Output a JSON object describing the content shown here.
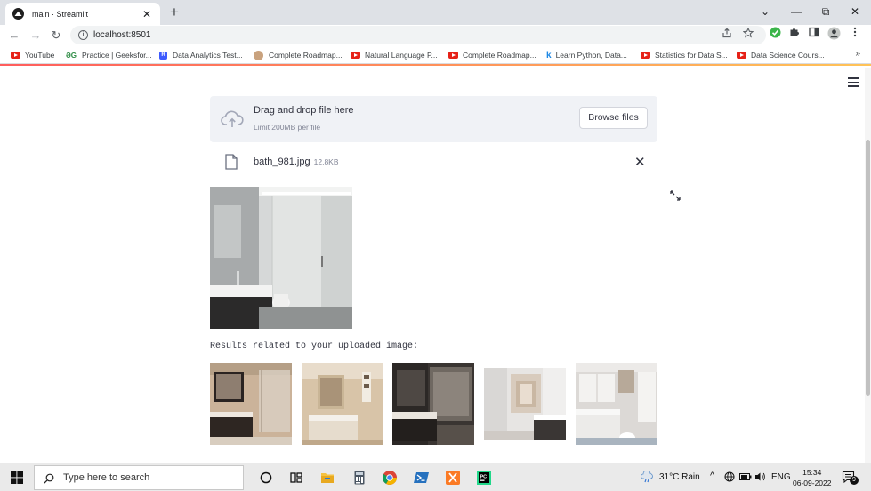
{
  "browser": {
    "tab_title": "main · Streamlit",
    "tab_close": "✕",
    "new_tab": "+",
    "window_controls": {
      "minimize": "—",
      "maximize": "⧉",
      "close": "✕",
      "tab_list": "⌄"
    },
    "url": "localhost:8501",
    "nav": {
      "back": "←",
      "forward": "→",
      "reload": "↻"
    }
  },
  "bookmarks": [
    {
      "icon": "youtube",
      "label": "YouTube"
    },
    {
      "icon": "gfg",
      "label": "Practice | Geeksfor..."
    },
    {
      "icon": "r",
      "label": "Data Analytics Test..."
    },
    {
      "icon": "avatar",
      "label": "Complete Roadmap..."
    },
    {
      "icon": "youtube",
      "label": "Natural Language P..."
    },
    {
      "icon": "youtube",
      "label": "Complete Roadmap..."
    },
    {
      "icon": "k",
      "label": "Learn Python, Data..."
    },
    {
      "icon": "youtube",
      "label": "Statistics for Data S..."
    },
    {
      "icon": "youtube",
      "label": "Data Science Cours..."
    }
  ],
  "bookmarks_more": "»",
  "uploader": {
    "title": "Drag and drop file here",
    "limit": "Limit 200MB per file",
    "browse_label": "Browse files"
  },
  "file": {
    "name": "bath_981.jpg",
    "size": "12.8KB",
    "remove": "✕"
  },
  "results_label": "Results related to your uploaded image:",
  "taskbar": {
    "search_placeholder": "Type here to search",
    "weather": "31°C  Rain",
    "lang": "ENG",
    "time": "15:34",
    "date": "06-09-2022",
    "notifications": "9"
  },
  "colors": {
    "accent": "#ff4b4b",
    "dropzone_bg": "#f0f2f6",
    "text": "#31333f"
  }
}
